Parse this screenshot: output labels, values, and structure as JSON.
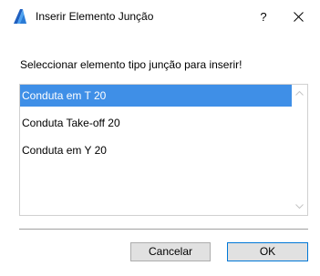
{
  "window": {
    "title": "Inserir Elemento Junção",
    "help_label": "?",
    "close_icon": "close-icon",
    "app_icon": "archicad-icon"
  },
  "dialog": {
    "instruction": "Seleccionar elemento tipo junção para inserir!",
    "list": {
      "selected_index": 0,
      "items": [
        {
          "label": "Conduta em T 20"
        },
        {
          "label": "Conduta Take-off 20"
        },
        {
          "label": "Conduta em Y 20"
        }
      ]
    },
    "buttons": {
      "cancel_label": "Cancelar",
      "ok_label": "OK"
    }
  },
  "colors": {
    "selection": "#3f8fe7",
    "default_button_border": "#0078d7"
  }
}
